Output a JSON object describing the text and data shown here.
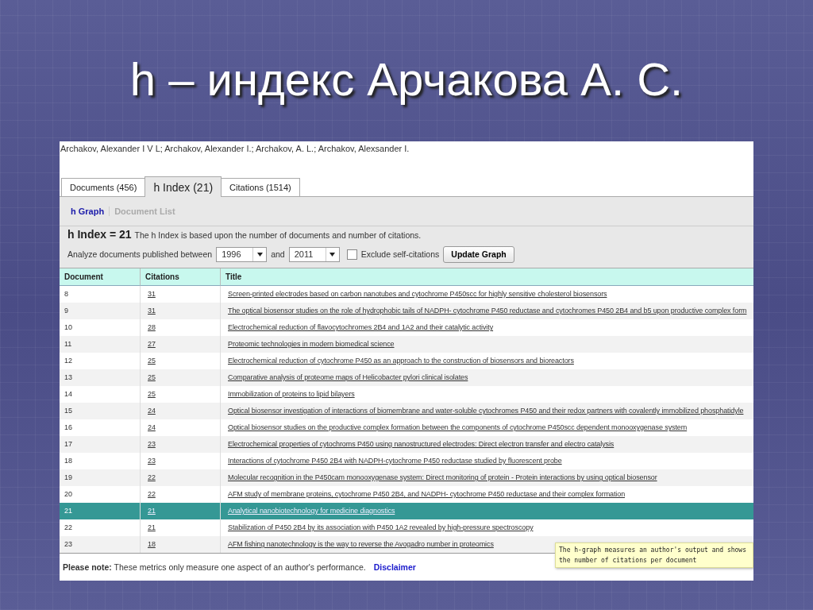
{
  "slide_title": "h – индекс Арчакова А. С.",
  "authors": "Archakov, Alexander I V L; Archakov, Alexander I.; Archakov, A. L.; Archakov, Alexsander I.",
  "tabs": [
    {
      "label": "Documents (456)",
      "selected": false
    },
    {
      "label": "h Index (21)",
      "selected": true
    },
    {
      "label": "Citations (1514)",
      "selected": false
    }
  ],
  "subnav": [
    {
      "label": "h Graph",
      "selected": true
    },
    {
      "label": "Document List",
      "selected": false
    }
  ],
  "h_index": {
    "heading": "h Index = 21",
    "description": "The h Index is based upon the number of documents and number of citations."
  },
  "filter": {
    "label": "Analyze documents published between",
    "from": "1996",
    "joiner": "and",
    "to": "2011",
    "exclude_label": "Exclude self-citations",
    "exclude_checked": false,
    "button": "Update Graph"
  },
  "table": {
    "columns": [
      "Document",
      "Citations",
      "Title"
    ],
    "rows": [
      {
        "document": "8",
        "citations": "31",
        "title": "Screen-printed electrodes based on carbon nanotubes and cytochrome P450scc for highly sensitive cholesterol biosensors",
        "selected": false
      },
      {
        "document": "9",
        "citations": "31",
        "title": "The optical biosensor studies on the role of hydrophobic tails of NADPH- cytochrome P450 reductase and cytochromes P450 2B4 and b5 upon productive complex form",
        "selected": false
      },
      {
        "document": "10",
        "citations": "28",
        "title": "Electrochemical reduction of flavocytochromes 2B4 and 1A2 and their catalytic activity",
        "selected": false
      },
      {
        "document": "11",
        "citations": "27",
        "title": "Proteomic technologies in modern biomedical science",
        "selected": false
      },
      {
        "document": "12",
        "citations": "25",
        "title": "Electrochemical reduction of cytochrome P450 as an approach to the construction of biosensors and bioreactors",
        "selected": false
      },
      {
        "document": "13",
        "citations": "25",
        "title": "Comparative analysis of proteome maps of Helicobacter pylori clinical isolates",
        "selected": false
      },
      {
        "document": "14",
        "citations": "25",
        "title": "Immobilization of proteins to lipid bilayers",
        "selected": false
      },
      {
        "document": "15",
        "citations": "24",
        "title": "Optical biosensor investigation of interactions of biomembrane and water-soluble cytochromes P450 and their redox partners with covalently immobilized phosphatidyle",
        "selected": false
      },
      {
        "document": "16",
        "citations": "24",
        "title": "Optical biosensor studies on the productive complex formation between the components of cytochrome P450scc dependent monooxygenase system",
        "selected": false
      },
      {
        "document": "17",
        "citations": "23",
        "title": "Electrochemical properties of cytochroms P450 using nanostructured electrodes: Direct electron transfer and electro catalysis",
        "selected": false
      },
      {
        "document": "18",
        "citations": "23",
        "title": "Interactions of cytochrome P450 2B4 with NADPH-cytochrome P450 reductase studied by fluorescent probe",
        "selected": false
      },
      {
        "document": "19",
        "citations": "22",
        "title": "Molecular recognition in the P450cam monooxygenase system: Direct monitoring of protein - Protein interactions by using optical biosensor",
        "selected": false
      },
      {
        "document": "20",
        "citations": "22",
        "title": "AFM study of membrane proteins, cytochrome P450 2B4, and NADPH- cytochrome P450 reductase and their complex formation",
        "selected": false
      },
      {
        "document": "21",
        "citations": "21",
        "title": "Analytical nanobiotechnology for medicine diagnostics",
        "selected": true
      },
      {
        "document": "22",
        "citations": "21",
        "title": "Stabilization of P450 2B4 by its association with P450 1A2 revealed by high-pressure spectroscopy",
        "selected": false
      },
      {
        "document": "23",
        "citations": "18",
        "title": "AFM fishing nanotechnology is the way to reverse the Avogadro number in proteomics",
        "selected": false
      }
    ]
  },
  "note": {
    "label": "Please note:",
    "text": "These metrics only measure one aspect of an author's performance.",
    "link": "Disclaimer"
  },
  "tooltip": "The h-graph measures an author's output and shows the number of citations per document"
}
